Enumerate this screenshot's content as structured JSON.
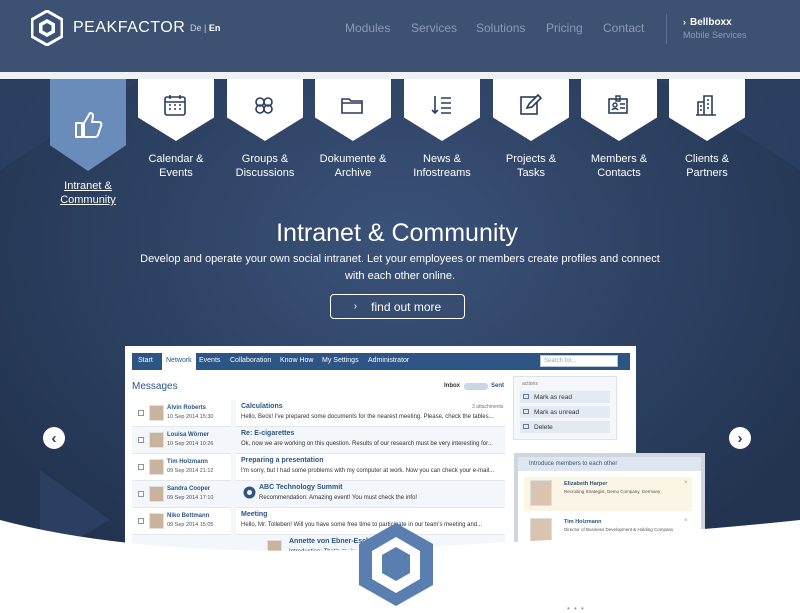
{
  "header": {
    "brand_name": "PEAKFACTOR",
    "lang_de": "De",
    "lang_sep": "|",
    "lang_en": "En",
    "nav": [
      "Modules",
      "Services",
      "Solutions",
      "Pricing",
      "Contact"
    ],
    "partner_name": "Bellboxx",
    "partner_sub": "Mobile Services",
    "colors": {
      "header_bg": "#3d5272",
      "body_bg": "#2a3d5c",
      "accent": "#6a8cbb"
    }
  },
  "features": [
    {
      "icon": "thumbs-up-icon",
      "label_line1": "Intranet &",
      "label_line2": "Community",
      "active": true
    },
    {
      "icon": "calendar-icon",
      "label_line1": "Calendar &",
      "label_line2": "Events",
      "active": false
    },
    {
      "icon": "groups-icon",
      "label_line1": "Groups &",
      "label_line2": "Discussions",
      "active": false
    },
    {
      "icon": "folder-icon",
      "label_line1": "Dokumente &",
      "label_line2": "Archive",
      "active": false
    },
    {
      "icon": "newsfeed-icon",
      "label_line1": "News &",
      "label_line2": "Infostreams",
      "active": false
    },
    {
      "icon": "edit-icon",
      "label_line1": "Projects &",
      "label_line2": "Tasks",
      "active": false
    },
    {
      "icon": "id-card-icon",
      "label_line1": "Members &",
      "label_line2": "Contacts",
      "active": false
    },
    {
      "icon": "buildings-icon",
      "label_line1": "Clients &",
      "label_line2": "Partners",
      "active": false
    }
  ],
  "hero": {
    "title": "Intranet & Community",
    "description": "Develop and operate your own social intranet. Let your employees or members create profiles and connect with each other online.",
    "cta_label": "find out more",
    "cta_chevron": "›"
  },
  "carousel": {
    "prev": "‹",
    "next": "›"
  },
  "app": {
    "nav": [
      "Start",
      "Network",
      "Events",
      "Collaboration",
      "Know How",
      "My Settings",
      "Administrator"
    ],
    "active_nav": "Network",
    "search_placeholder": "Search for...",
    "messages_title": "Messages",
    "inbox_label": "Inbox",
    "sent_label": "Sent",
    "messages": [
      {
        "name": "Alvin Roberts",
        "date": "10 Sep 2014 15:30",
        "subject": "Calculations",
        "preview": "Hello, Beck! I've prepared some documents for the nearest meeting. Please, check the tables...",
        "attachments": "3 attachments"
      },
      {
        "name": "Louisa Wörner",
        "date": "10 Sep 2014 10:26",
        "subject": "Re: E-cigarettes",
        "preview": "Ok, now we are working on this question. Results of our research must be very interesting for...",
        "attachments": ""
      },
      {
        "name": "Tim Holzmann",
        "date": "09 Sep 2014 21:12",
        "subject": "Preparing a presentation",
        "preview": "I'm sorry, but I had some problems with my computer at work. Now you can check your e-mail...",
        "attachments": ""
      },
      {
        "name": "Sandra Cooper",
        "date": "09 Sep 2014 17:10",
        "subject": "ABC Technology Summit",
        "preview": "Recommendation: Amazing event! You must check the info!",
        "attachments": ""
      },
      {
        "name": "Niko Bettmann",
        "date": "09 Sep 2014 15:05",
        "subject": "Meeting",
        "preview": "Hello, Mr. Tolleben! Will you have some free time to participate in our team's meeting and...",
        "attachments": ""
      },
      {
        "name": "",
        "date": "",
        "subject": "Annette von Ebner-Eschenbruck",
        "preview": "Introduction: That's my buddy! ... Add them to your",
        "attachments": ""
      }
    ],
    "actions_header": "actions",
    "actions": [
      "Mark as read",
      "Mark as unread",
      "Delete"
    ],
    "popup_title": "Introduce members to each other",
    "intro_cards": [
      {
        "name": "Elizabeth Harper",
        "role": "Recruiting Strategist, Demo Company, Germany"
      },
      {
        "name": "Tim Holzmann",
        "role": "Director of Business Development & Holding Company"
      }
    ],
    "popup_close": "×"
  },
  "footer_dots": "• • •"
}
